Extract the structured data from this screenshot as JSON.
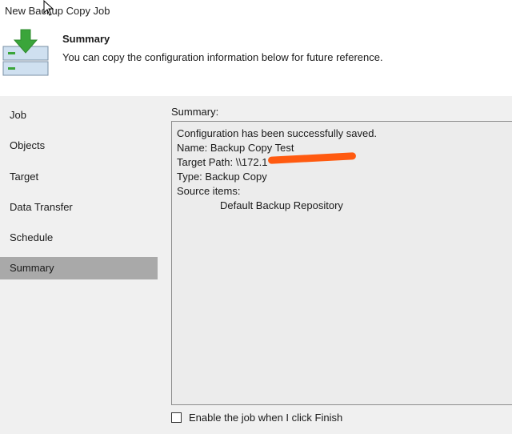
{
  "window": {
    "title": "New Backup Copy Job"
  },
  "header": {
    "icon": "download-arrow-server-icon",
    "title": "Summary",
    "description": "You can copy the configuration information below for future reference."
  },
  "nav": {
    "items": [
      {
        "label": "Job"
      },
      {
        "label": "Objects"
      },
      {
        "label": "Target"
      },
      {
        "label": "Data Transfer"
      },
      {
        "label": "Schedule"
      },
      {
        "label": "Summary",
        "active": true
      }
    ]
  },
  "summary": {
    "label": "Summary:",
    "lines": [
      "Configuration has been successfully saved.",
      "Name: Backup Copy Test",
      "Target Path: \\\\172.1",
      "Type: Backup Copy",
      "Source items:",
      "Default Backup Repository"
    ]
  },
  "options": {
    "enable_job_label": "Enable the job when I click Finish",
    "enable_job_checked": false
  },
  "colors": {
    "accent_green": "#3aa53a",
    "selected_nav": "#a9a9a9",
    "redaction": "#ff5a10"
  }
}
